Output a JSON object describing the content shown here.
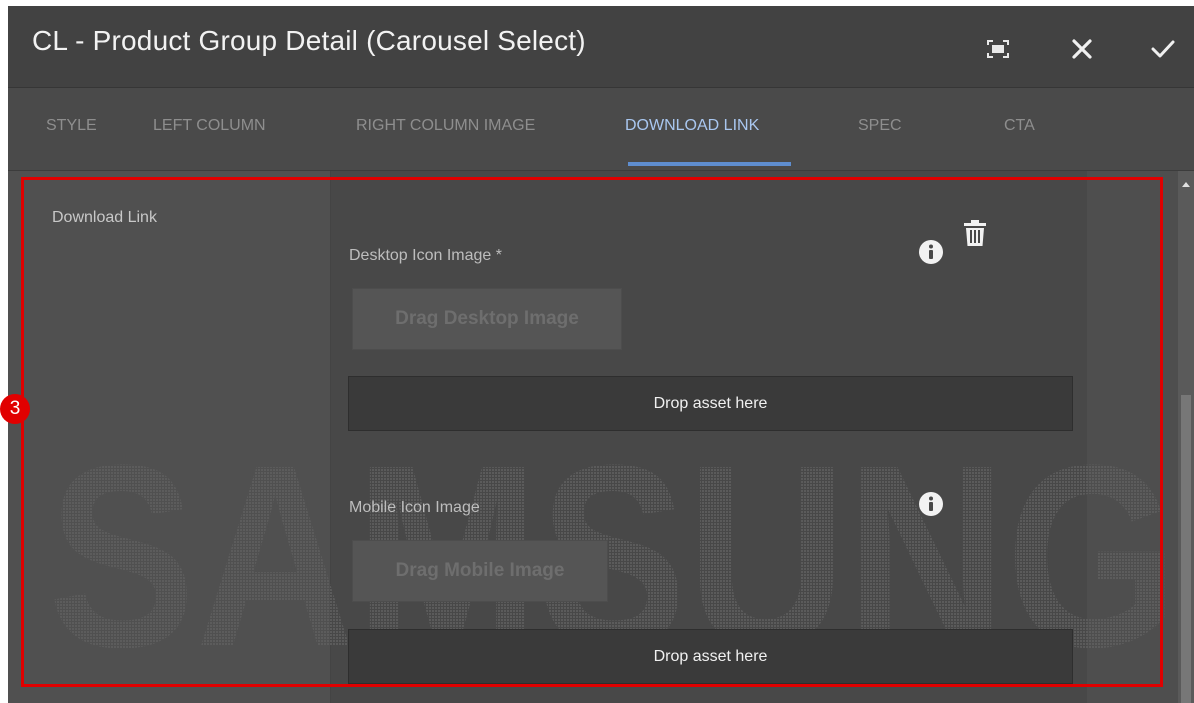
{
  "dialog": {
    "title": "CL - Product Group Detail (Carousel Select)",
    "icons": [
      "fullscreen-icon",
      "close-icon",
      "check-icon"
    ]
  },
  "tabs": [
    {
      "label": "STYLE",
      "active": false
    },
    {
      "label": "LEFT COLUMN",
      "active": false
    },
    {
      "label": "RIGHT COLUMN IMAGE",
      "active": false
    },
    {
      "label": "DOWNLOAD LINK",
      "active": true
    },
    {
      "label": "SPEC",
      "active": false
    },
    {
      "label": "CTA",
      "active": false
    }
  ],
  "section": {
    "label": "Download Link"
  },
  "fields": {
    "desktop": {
      "label": "Desktop Icon Image *",
      "drag_label": "Drag Desktop Image",
      "drop_label": "Drop asset here"
    },
    "mobile": {
      "label": "Mobile Icon Image",
      "drag_label": "Drag Mobile Image",
      "drop_label": "Drop asset here"
    }
  },
  "watermark": "SAMSUNG",
  "annotation": {
    "badge": "3",
    "color": "#e00000"
  },
  "colors": {
    "accent": "#5f8ed0",
    "active_tab": "#a9c7f0",
    "panel": "#4a4a4a"
  }
}
